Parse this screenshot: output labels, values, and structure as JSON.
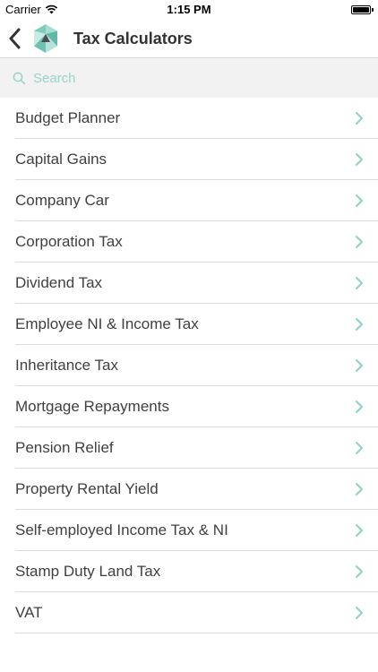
{
  "status_bar": {
    "carrier": "Carrier",
    "time": "1:15 PM",
    "battery_level": 1.0
  },
  "nav": {
    "title": "Tax Calculators",
    "back_icon": "chevron-left-icon",
    "logo_icon": "app-logo-icon"
  },
  "search": {
    "placeholder": "Search",
    "icon": "search-icon"
  },
  "colors": {
    "accent": "#7fcbbd",
    "chevron": "#8fd1c4",
    "search_placeholder": "#9ad3c9",
    "search_bg": "#f2f2f2",
    "separator": "#dcdcdc"
  },
  "items": [
    {
      "label": "Budget Planner"
    },
    {
      "label": "Capital Gains"
    },
    {
      "label": "Company Car"
    },
    {
      "label": "Corporation Tax"
    },
    {
      "label": "Dividend Tax"
    },
    {
      "label": "Employee NI & Income Tax"
    },
    {
      "label": "Inheritance Tax"
    },
    {
      "label": "Mortgage Repayments"
    },
    {
      "label": "Pension Relief"
    },
    {
      "label": "Property Rental Yield"
    },
    {
      "label": "Self-employed Income Tax & NI"
    },
    {
      "label": "Stamp Duty Land Tax"
    },
    {
      "label": "VAT"
    }
  ]
}
